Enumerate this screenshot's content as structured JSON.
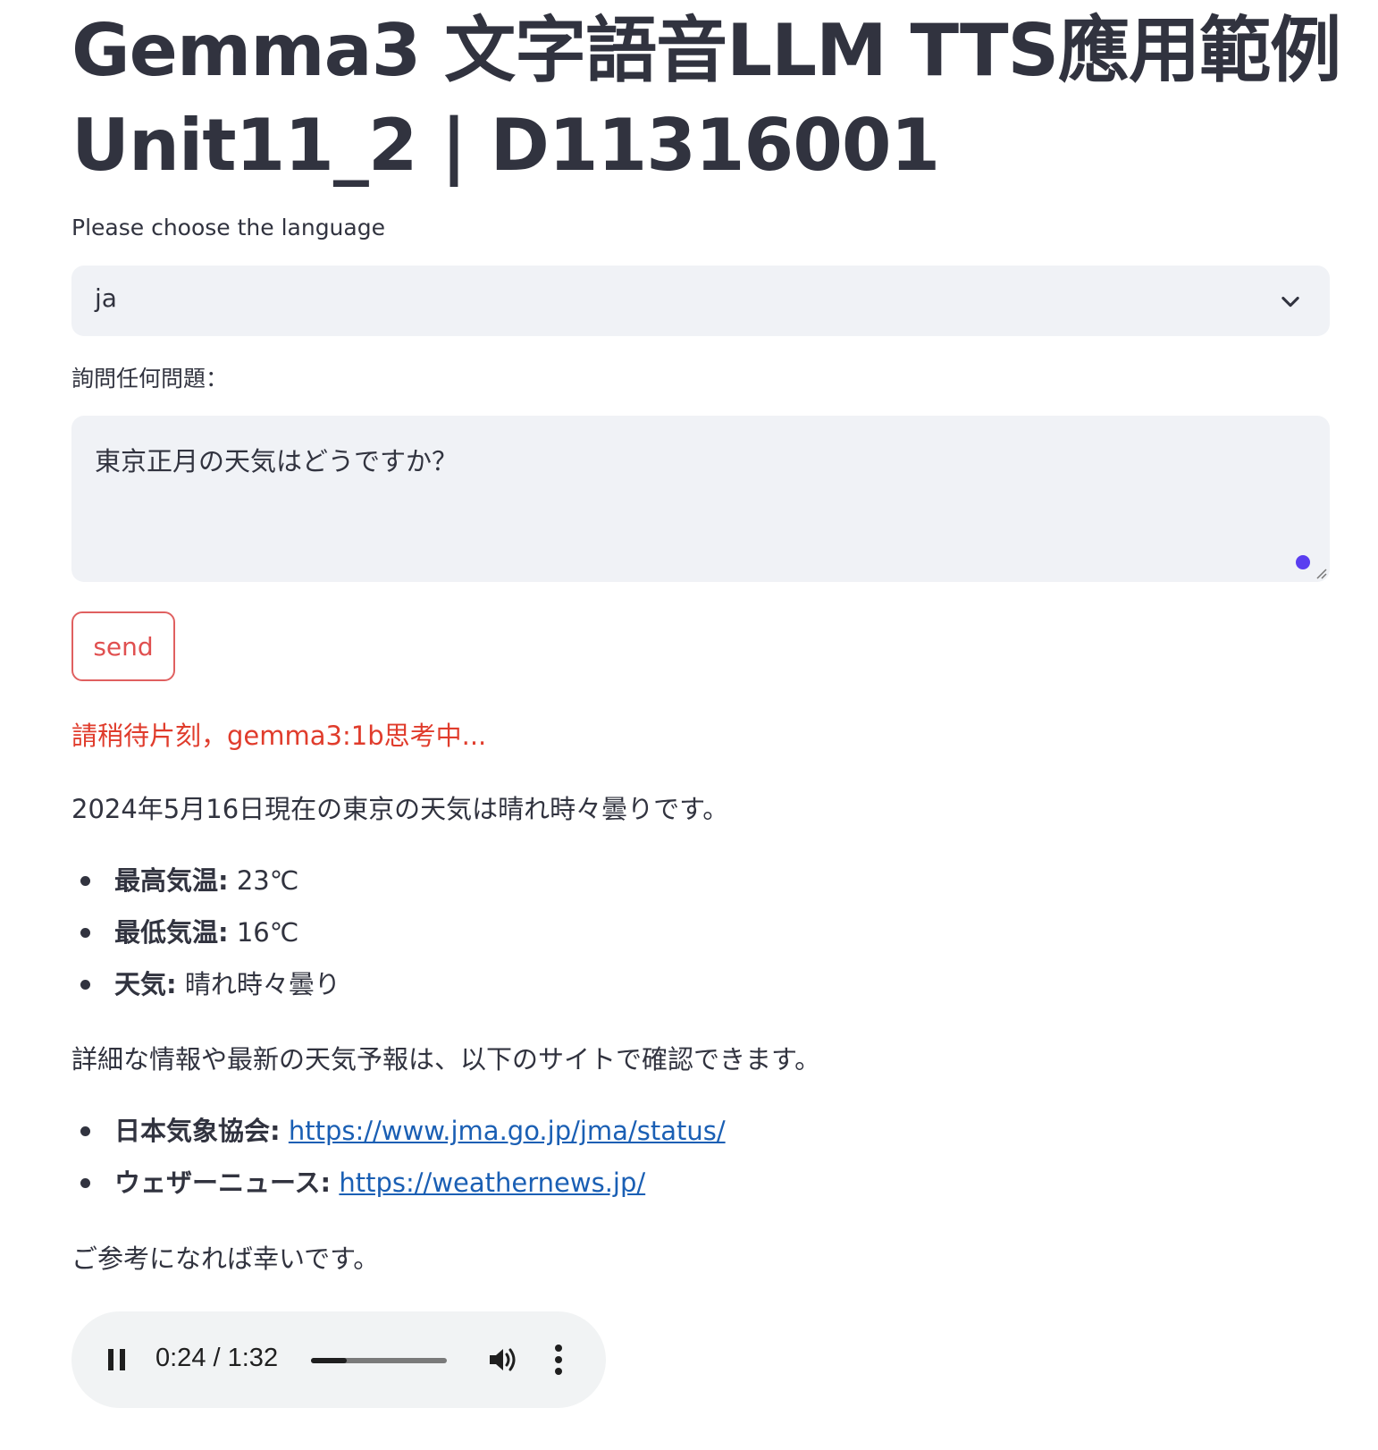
{
  "header": {
    "title": "Gemma3 文字語音LLM TTS應用範例Unit11_2 | D11316001"
  },
  "language_select": {
    "label": "Please choose the language",
    "value": "ja"
  },
  "question": {
    "label": "詢問任何問題：",
    "value": "東京正月の天気はどうですか？"
  },
  "send_button": {
    "label": "send"
  },
  "status": {
    "waiting_text": "請稍待片刻，gemma3:1b思考中..."
  },
  "answer": {
    "intro": "2024年5月16日現在の東京の天気は晴れ時々曇りです。",
    "weather_items": [
      {
        "key": "最高気温:",
        "value": " 23℃"
      },
      {
        "key": "最低気温:",
        "value": " 16℃"
      },
      {
        "key": "天気:",
        "value": " 晴れ時々曇り"
      }
    ],
    "details_text": "詳細な情報や最新の天気予報は、以下のサイトで確認できます。",
    "links": [
      {
        "key": "日本気象協会:",
        "url_text": "https://www.jma.go.jp/jma/status/"
      },
      {
        "key": "ウェザーニュース:",
        "url_text": "https://weathernews.jp/"
      }
    ],
    "closing": "ご参考になれば幸いです。"
  },
  "audio_player": {
    "current_time": "0:24",
    "separator": " / ",
    "duration": "1:32",
    "progress_fraction": 0.26,
    "icons": [
      "pause-icon",
      "volume-icon",
      "more-options-icon"
    ]
  },
  "colors": {
    "text": "#31333f",
    "accent_red": "#e03c2c",
    "input_bg": "#f0f2f6",
    "link": "#1a5fb4",
    "focus": "#5a3ef0"
  }
}
